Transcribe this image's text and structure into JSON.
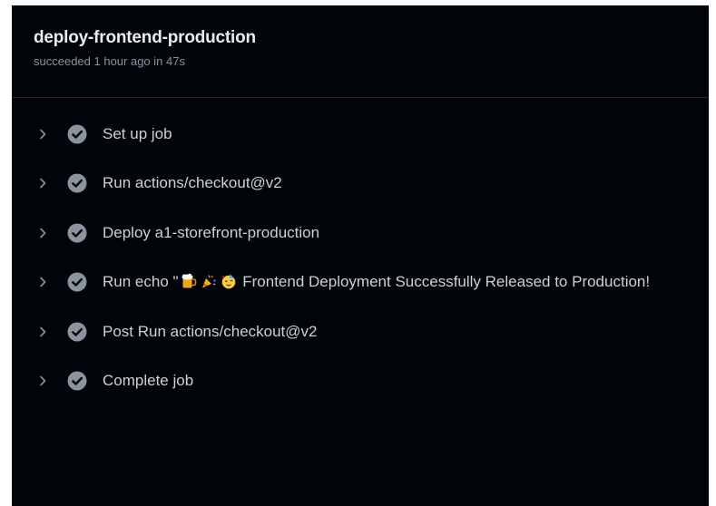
{
  "job": {
    "title": "deploy-frontend-production",
    "status_text": "succeeded 1 hour ago in 47s"
  },
  "steps": [
    {
      "label": "Set up job",
      "status": "success"
    },
    {
      "label": "Run actions/checkout@v2",
      "status": "success"
    },
    {
      "label": "Deploy a1-storefront-production",
      "status": "success"
    },
    {
      "label_prefix": "Run echo \"",
      "emojis": [
        "beer-mug-emoji",
        "party-popper-emoji",
        "partying-face-emoji"
      ],
      "label_suffix": " Frontend Deployment Successfully Released to Production!",
      "status": "success"
    },
    {
      "label": "Post Run actions/checkout@v2",
      "status": "success"
    },
    {
      "label": "Complete job",
      "status": "success"
    }
  ],
  "colors": {
    "panel_background": "#010409",
    "title_text": "#e6edf3",
    "muted_text": "#8b949e",
    "step_text": "#c9d1d9",
    "success_icon": "#8b949e"
  }
}
